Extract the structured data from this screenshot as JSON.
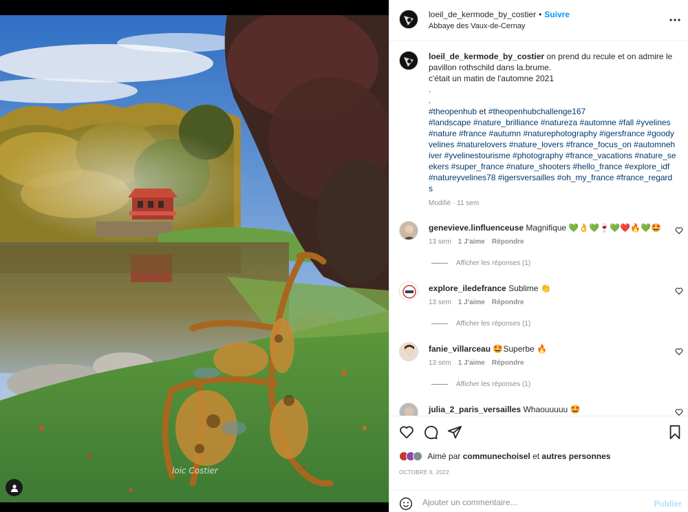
{
  "post": {
    "author": "loeil_de_kermode_by_costier",
    "follow_label": "Suivre",
    "separator": "•",
    "location": "Abbaye des Vaux-de-Cernay",
    "more_icon": "more-horizontal-icon",
    "watermark": "loic Costier"
  },
  "caption": {
    "user": "loeil_de_kermode_by_costier",
    "line1": " on prend du recule et on admire le pavillon rothschild dans la.brume.",
    "line2": "c'était un matin de l'automne 2021",
    "dot1": ".",
    "dot2": ".",
    "tags1_a": "#theopenhub",
    "tags1_et": " et ",
    "tags1_b": "#theopenhubchallenge167",
    "tags2": "#landscape #nature_brilliance #natureza #automne #fall #yvelines #nature #france #autumn #naturephotography #igersfrance #goodyvelines #naturelovers #nature_lovers #france_focus_on #automnehiver #yvelinestourisme #photography #france_vacations #nature_seekers #super_france #nature_shooters #hello_france #explore_idf #natureyvelines78 #igersversailles #oh_my_france #france_regards",
    "meta": "Modifié · 11 sem"
  },
  "comments": [
    {
      "user": "genevieve.linfluenceuse",
      "text": " Magnifique 💚👌💚🍷💚❤️🔥💚🤩",
      "age": "13 sem",
      "likes": "1 J'aime",
      "reply": "Répondre",
      "replies": "Afficher les réponses (1)"
    },
    {
      "user": "explore_iledefrance",
      "text": " Sublime 👏",
      "age": "13 sem",
      "likes": "1 J'aime",
      "reply": "Répondre",
      "replies": "Afficher les réponses (1)"
    },
    {
      "user": "fanie_villarceau",
      "text": " 🤩Superbe 🔥",
      "age": "13 sem",
      "likes": "1 J'aime",
      "reply": "Répondre",
      "replies": "Afficher les réponses (1)"
    },
    {
      "user": "julia_2_paris_versailles",
      "text": " Whaouuuuu 🤩"
    }
  ],
  "likes": {
    "prefix": "Aimé par ",
    "user": "communechoisel",
    "mid": " et ",
    "others": "autres personnes"
  },
  "date": "OCTOBRE 6, 2022",
  "composer": {
    "placeholder": "Ajouter un commentaire...",
    "publish": "Publier"
  },
  "colors": {
    "link": "#0095f6",
    "hashtag": "#00376b",
    "muted": "#8e8e8e"
  }
}
